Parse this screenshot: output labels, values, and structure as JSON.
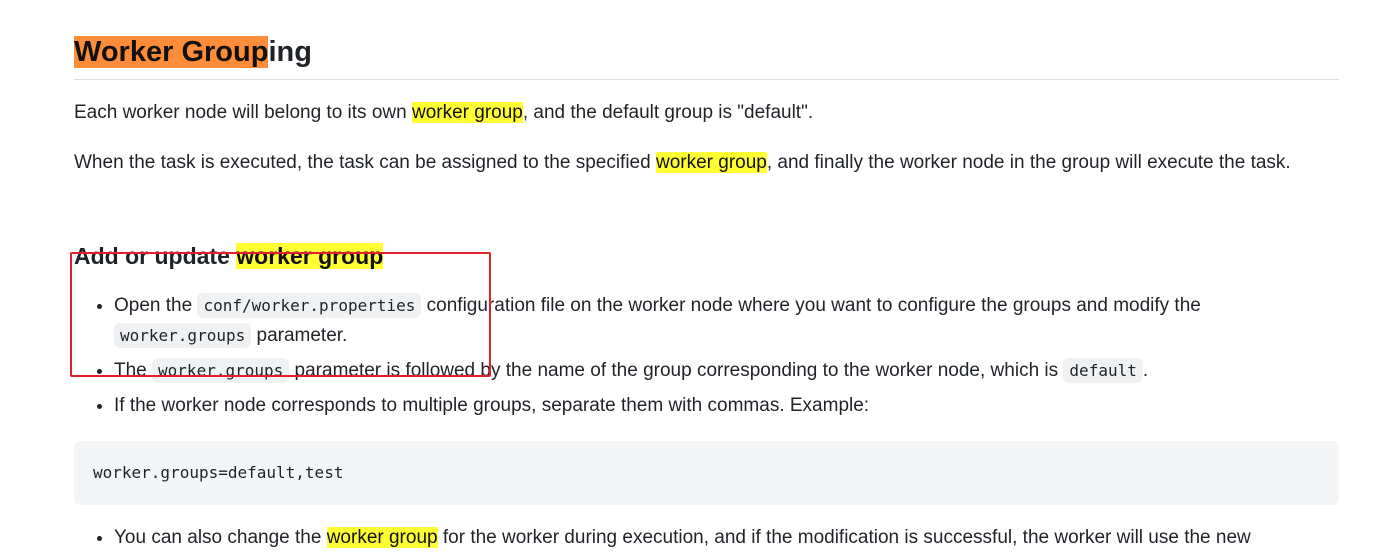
{
  "heading": {
    "highlight": "Worker Group",
    "rest": "ing"
  },
  "para1": {
    "before": "Each worker node will belong to its own ",
    "highlight": "worker group",
    "after": ", and the default group is \"default\"."
  },
  "para2": {
    "before": "When the task is executed, the task can be assigned to the specified ",
    "highlight": "worker group",
    "after": ", and finally the worker node in the group will execute the task."
  },
  "subheading": {
    "before": "Add or update ",
    "highlight": "worker group"
  },
  "bullets": [
    {
      "t1": "Open the ",
      "code1": "conf/worker.properties",
      "t2": " configuration file on the worker node where you want to configure the groups and modify the ",
      "code2": "worker.groups",
      "t3": " parameter."
    },
    {
      "t1": "The ",
      "code1": "worker.groups",
      "t2": " parameter is followed by the name of the group corresponding to the worker node, which is ",
      "code2": "default",
      "t3": "."
    },
    {
      "t1": "If the worker node corresponds to multiple groups, separate them with commas. Example:"
    }
  ],
  "code_block": "worker.groups=default,test",
  "last_bullet": {
    "before": "You can also change the ",
    "highlight": "worker group",
    "after": " for the worker during execution, and if the modification is successful, the worker will use the new"
  },
  "colors": {
    "heading_highlight": "#ff8c38",
    "search_highlight": "#ffff33",
    "annotation_box": "#e0202a"
  }
}
